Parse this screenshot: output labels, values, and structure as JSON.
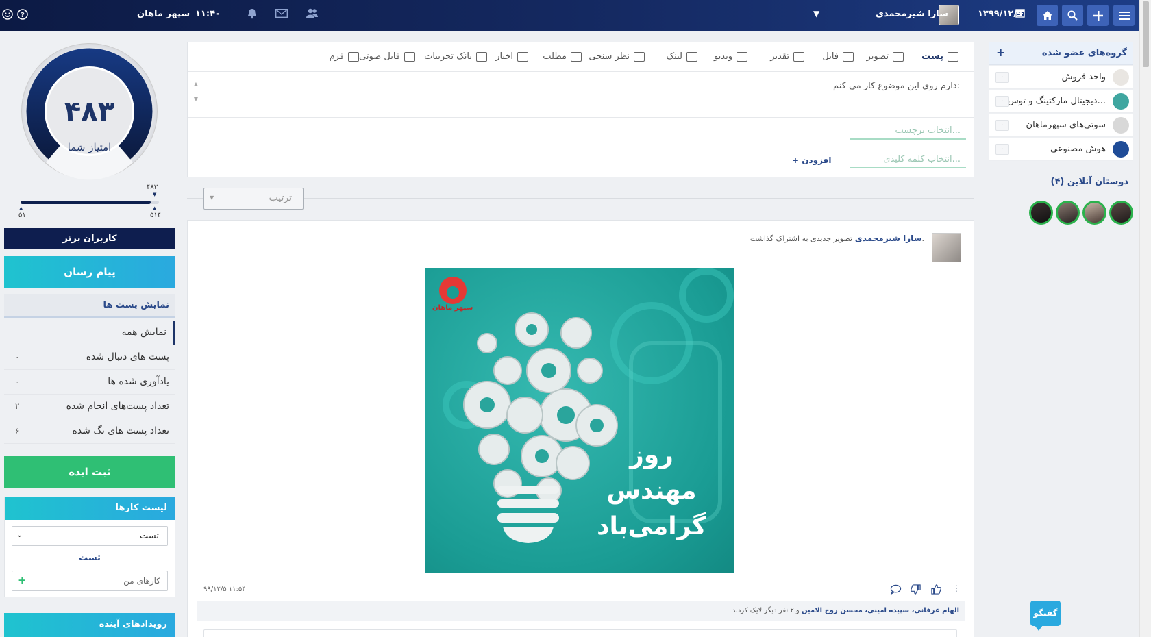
{
  "topbar": {
    "date": "۱۳۹۹/۱۲/۹",
    "user_name": "سارا شیرمحمدی",
    "time": "۱۱:۴۰",
    "company": "سپهر ماهان",
    "icons": [
      "menu-icon",
      "plus-icon",
      "search-icon",
      "home-icon",
      "calendar-icon",
      "dropdown-caret-icon",
      "users-icon",
      "mail-icon",
      "bell-icon",
      "help-icon",
      "smiley-icon"
    ]
  },
  "right_sidebar": {
    "groups_title": "گروه‌های عضو شده",
    "groups_add": "+",
    "groups": [
      {
        "name": "واحد فروش",
        "count": "۰",
        "avatar_color": "#e9e6e2"
      },
      {
        "name": "دیجیتال مارکتینگ و توس...",
        "count": "۰",
        "avatar_color": "#3fa6a0"
      },
      {
        "name": "سوتی‌های سپهرماهان",
        "count": "۰",
        "avatar_color": "#d8d8d8"
      },
      {
        "name": "هوش مصنوعی",
        "count": "۰",
        "avatar_color": "#1f4c97"
      }
    ],
    "online_title": "دوستان آنلاین (۴)"
  },
  "composer": {
    "tabs": [
      {
        "label": "پست",
        "icon": "post-icon",
        "active": true
      },
      {
        "label": "تصویر",
        "icon": "image-icon"
      },
      {
        "label": "فایل",
        "icon": "paperclip-icon"
      },
      {
        "label": "تقدیر",
        "icon": "gift-icon"
      },
      {
        "label": "ویدیو",
        "icon": "film-icon"
      },
      {
        "label": "لینک",
        "icon": "link-icon"
      },
      {
        "label": "نظر سنجی",
        "icon": "poll-icon"
      },
      {
        "label": "مطلب",
        "icon": "article-icon"
      },
      {
        "label": "اخبار",
        "icon": "news-icon"
      },
      {
        "label": "بانک تجربیات",
        "icon": "checklist-icon"
      },
      {
        "label": "فایل صوتی",
        "icon": "microphone-icon"
      },
      {
        "label": "فرم",
        "icon": "form-icon"
      }
    ],
    "textarea_placeholder": "دارم روی این موضوع کار می کنم:",
    "tag_placeholder": "انتخاب برچسب...",
    "keyword_placeholder": "انتخاب کلمه کلیدی...",
    "add_label": "+ افزودن"
  },
  "sort": {
    "label": "ترتیب"
  },
  "post": {
    "author": "سارا شیرمحمدی",
    "action": "تصویر جدیدی به اشتراک گذاشت.",
    "image_logo_text": "سپهر ماهان",
    "image_line1": "روز مهندس",
    "image_line2": "گرامی‌باد",
    "timestamp": "۹۹/۱۲/۵ ۱۱:۵۴",
    "likers_names": "الهام عرفانی، سپیده امینی، محسن روح الامین",
    "likers_suffix": "و ۲ نفر دیگر لایک کردند"
  },
  "left_sidebar": {
    "score_value": "۴۸۳",
    "score_label": "امتیاز شما",
    "slider_current": "۴۸۳",
    "slider_min": "۵۱",
    "slider_max": "۵۱۴",
    "slider_progress": 0.94,
    "top_users": "کاربران برتر",
    "messenger": "پیام رسان",
    "show_posts": "نمایش پست ها",
    "stats": [
      {
        "label": "نمایش همه",
        "value": ""
      },
      {
        "label": "پست های دنبال شده",
        "value": "۰"
      },
      {
        "label": "یادآوری شده ها",
        "value": "۰"
      },
      {
        "label": "تعداد پست‌های انجام شده",
        "value": "۲"
      },
      {
        "label": "تعداد پست های تگ شده",
        "value": "۶"
      }
    ],
    "submit_idea": "ثبت ایده",
    "task_list_title": "لیست کارها",
    "task_select_value": "تست",
    "task_name": "تست",
    "my_tasks_placeholder": "کارهای من",
    "upcoming_events": "رویدادهای آینده"
  },
  "chat_button": "گفتگو",
  "colors": {
    "navy": "#0c1a44",
    "accent_blue": "#3d63b8",
    "teal": "#1fb5c9",
    "green": "#2fbf74",
    "online_green": "#2bb24c"
  }
}
